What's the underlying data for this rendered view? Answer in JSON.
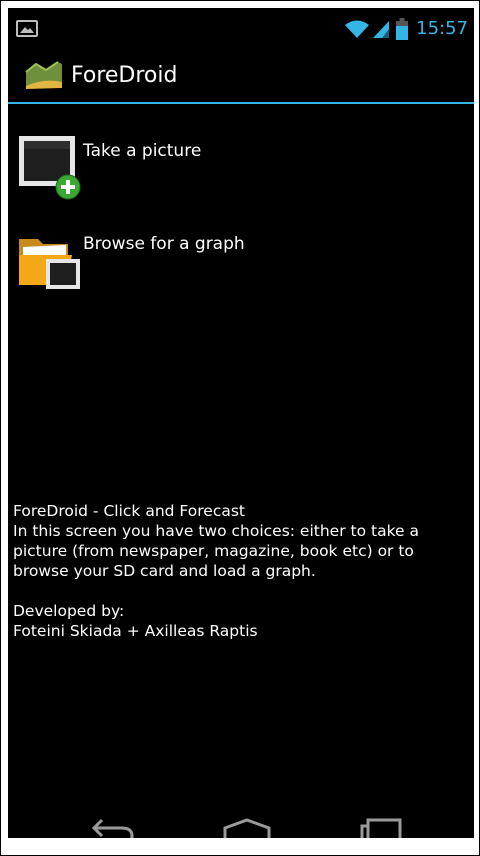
{
  "status_bar": {
    "time": "15:57",
    "icons": [
      "image-notification-icon",
      "wifi-icon",
      "signal-icon",
      "battery-icon"
    ]
  },
  "action_bar": {
    "title": "ForeDroid",
    "logo": "foredroid-logo-icon"
  },
  "menu": {
    "items": [
      {
        "label": "Take a picture",
        "icon": "camera-add-icon"
      },
      {
        "label": "Browse for a graph",
        "icon": "folder-image-icon"
      }
    ]
  },
  "info": {
    "heading": "ForeDroid - Click and Forecast",
    "description": "In this screen you have two choices: either to take a picture (from newspaper, magazine, book etc) or to browse your SD card and load a graph.",
    "developed_label": "Developed by:",
    "developers": "Foteini Skiada + Axilleas Raptis"
  },
  "nav_bar": {
    "buttons": [
      "back-icon",
      "home-icon",
      "recent-apps-icon"
    ]
  },
  "colors": {
    "accent": "#33b5e5",
    "background": "#000000",
    "text": "#ffffff",
    "add_badge": "#3aa832"
  }
}
